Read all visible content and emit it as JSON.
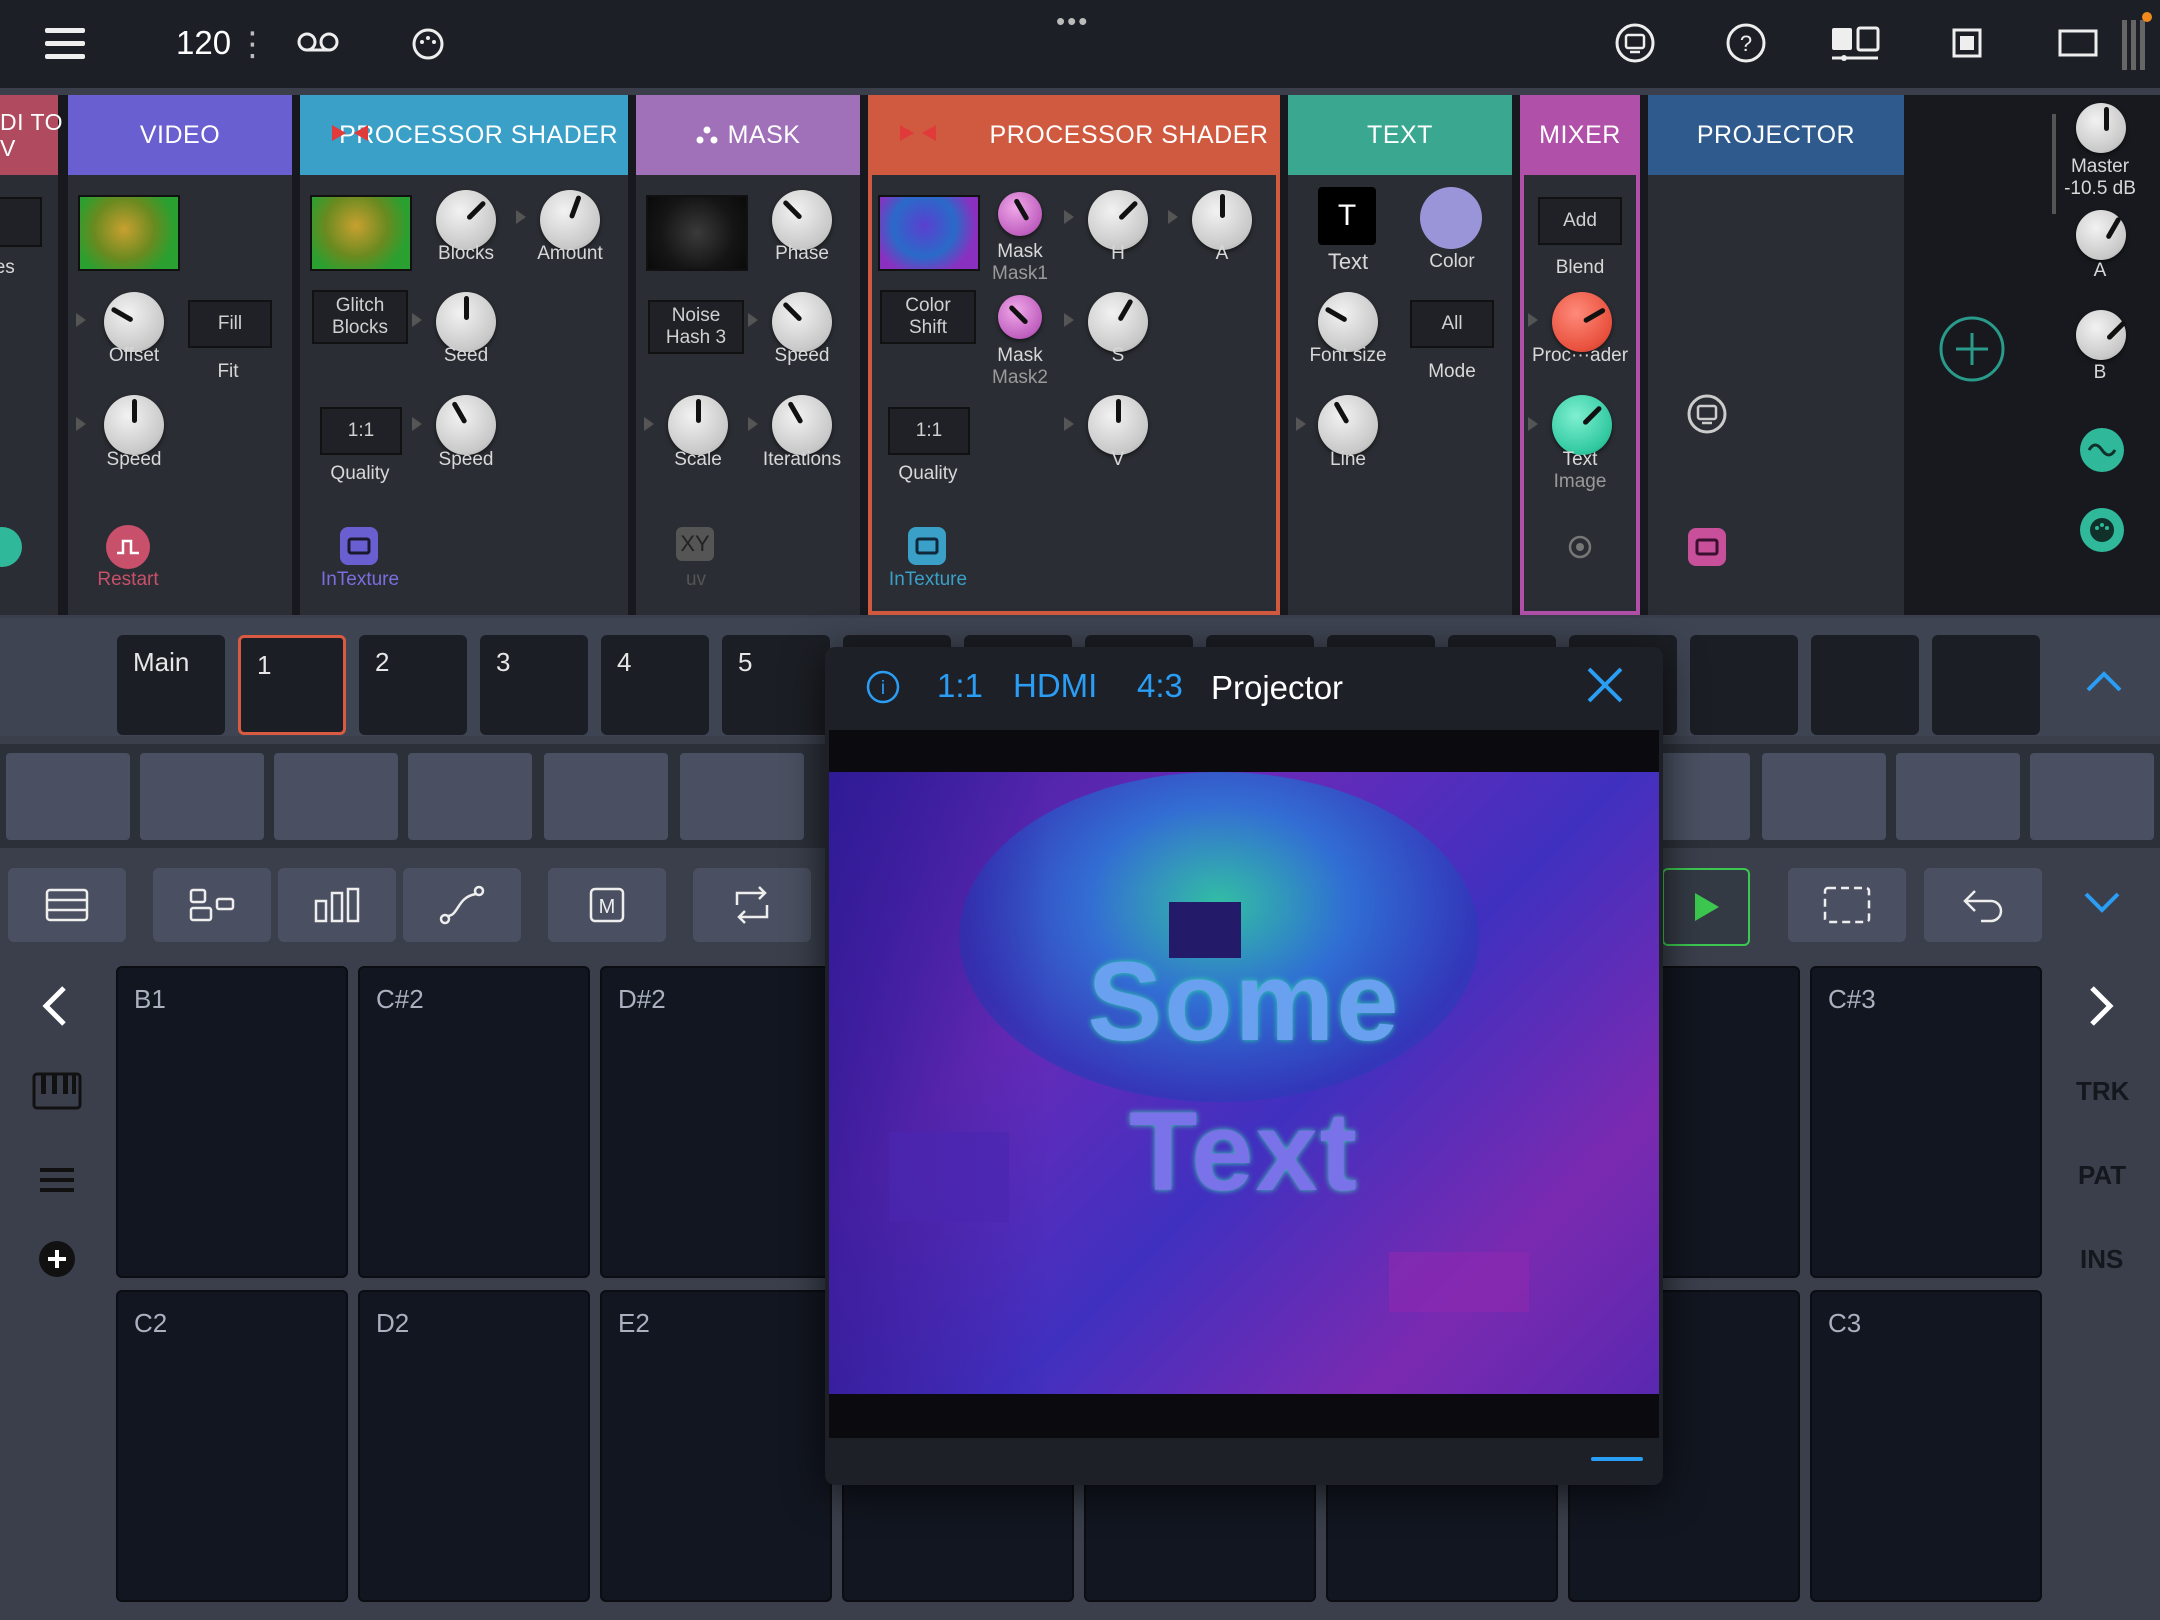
{
  "topbar": {
    "tempo": "120",
    "tempo_more": "⋮",
    "dots": "•••"
  },
  "modules": {
    "partial_title": "DI TO\nV",
    "partial_label": "ces",
    "video": {
      "title": "VIDEO",
      "offset": "Offset",
      "fill": "Fill",
      "fit": "Fit",
      "speed": "Speed",
      "restart": "Restart"
    },
    "proc1": {
      "title": "PROCESSOR SHADER",
      "blocks": "Blocks",
      "amount": "Amount",
      "glitch": "Glitch\nBlocks",
      "seed": "Seed",
      "ratio": "1:1",
      "speed": "Speed",
      "quality": "Quality",
      "intexture": "InTexture"
    },
    "mask": {
      "title": "MASK",
      "phase": "Phase",
      "noise": "Noise\nHash 3",
      "speed": "Speed",
      "scale": "Scale",
      "iterations": "Iterations",
      "xy": "XY",
      "uv": "uv"
    },
    "proc2": {
      "title": "PROCESSOR SHADER",
      "mask1": "Mask",
      "mask1_sub": "Mask1",
      "h": "H",
      "a": "A",
      "colorshift": "Color\nShift",
      "mask2": "Mask",
      "mask2_sub": "Mask2",
      "s": "S",
      "ratio": "1:1",
      "v": "V",
      "quality": "Quality",
      "intexture": "InTexture"
    },
    "text": {
      "title": "TEXT",
      "t_glyph": "T",
      "text": "Text",
      "color": "Color",
      "fontsize": "Font size",
      "all": "All",
      "mode": "Mode",
      "line": "Line"
    },
    "mixer": {
      "title": "MIXER",
      "add": "Add",
      "blend": "Blend",
      "procader": "Proc···ader",
      "text": "Text",
      "image": "Image"
    },
    "projector": {
      "title": "PROJECTOR"
    },
    "master": {
      "master": "Master",
      "db": "-10.5 dB",
      "a": "A",
      "b": "B"
    }
  },
  "scenes": [
    "Main",
    "1",
    "2",
    "3",
    "4",
    "5"
  ],
  "pads": {
    "row1": [
      "B1",
      "C#2",
      "D#2",
      "C#3"
    ],
    "row2": [
      "C2",
      "D2",
      "E2",
      "C3"
    ]
  },
  "side": {
    "trk": "TRK",
    "pat": "PAT",
    "ins": "INS"
  },
  "dialog": {
    "info": "i",
    "ratio": "1:1",
    "output": "HDMI",
    "aspect": "4:3",
    "title": "Projector",
    "line1": "Some",
    "line2": "Text"
  },
  "colors": {
    "video": "#6a5fd0",
    "proc1": "#3aa0c8",
    "mask": "#a070b8",
    "proc2": "#d05a40",
    "text": "#3aa890",
    "mixer": "#b050a8",
    "projector": "#2e5a8e",
    "accent": "#2a9df4"
  }
}
